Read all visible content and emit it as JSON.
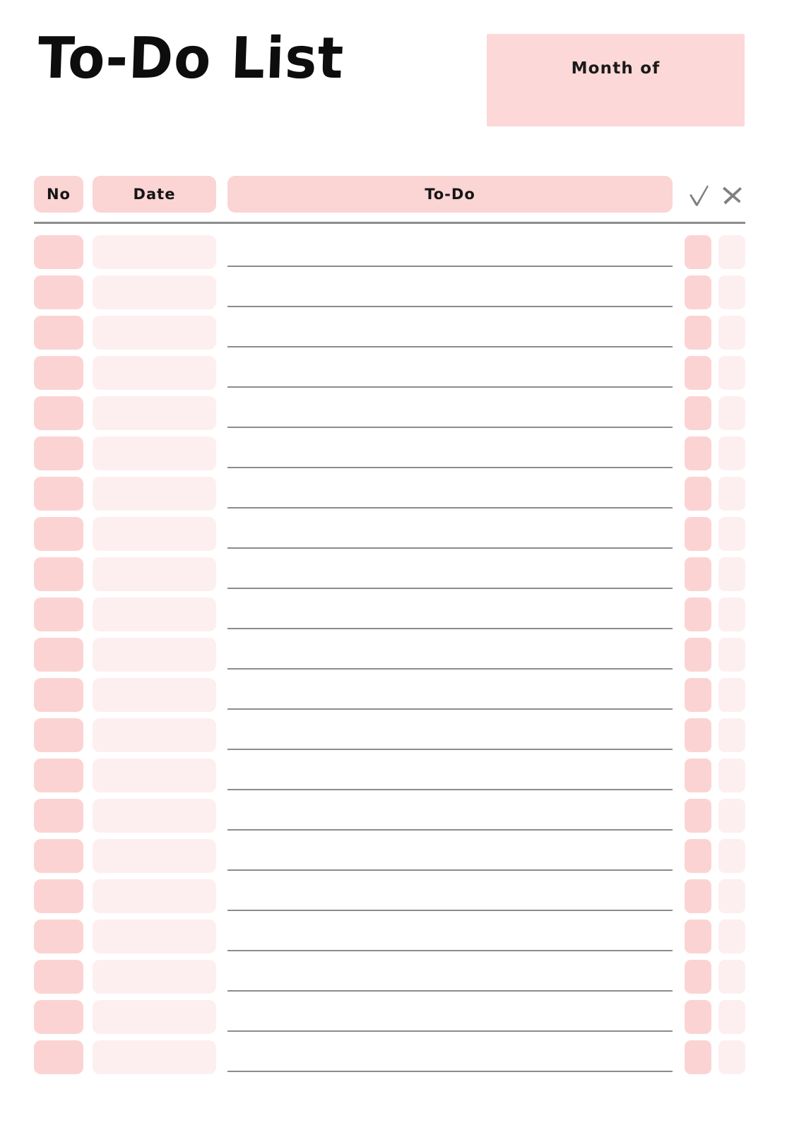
{
  "page": {
    "title": "To-Do List",
    "background_color": "#FFFFFF"
  },
  "header": {
    "month_box": {
      "label": "Month of",
      "value": "",
      "fill_color": "#FCD8D8"
    }
  },
  "table": {
    "columns": [
      {
        "key": "no",
        "label": "No",
        "type": "text",
        "fill_color": "#FBD4D4"
      },
      {
        "key": "date",
        "label": "Date",
        "type": "text",
        "fill_color": "#FBD4D4"
      },
      {
        "key": "todo",
        "label": "To-Do",
        "type": "text",
        "fill_color": "#FBD4D4"
      },
      {
        "key": "done",
        "label": "",
        "type": "icon",
        "icon": "check-icon",
        "icon_color": "#808080"
      },
      {
        "key": "undone",
        "label": "",
        "type": "icon",
        "icon": "cross-icon",
        "icon_color": "#808080"
      }
    ],
    "row_count": 21,
    "rows": [
      {
        "no": "",
        "date": "",
        "todo": "",
        "done": "",
        "undone": ""
      },
      {
        "no": "",
        "date": "",
        "todo": "",
        "done": "",
        "undone": ""
      },
      {
        "no": "",
        "date": "",
        "todo": "",
        "done": "",
        "undone": ""
      },
      {
        "no": "",
        "date": "",
        "todo": "",
        "done": "",
        "undone": ""
      },
      {
        "no": "",
        "date": "",
        "todo": "",
        "done": "",
        "undone": ""
      },
      {
        "no": "",
        "date": "",
        "todo": "",
        "done": "",
        "undone": ""
      },
      {
        "no": "",
        "date": "",
        "todo": "",
        "done": "",
        "undone": ""
      },
      {
        "no": "",
        "date": "",
        "todo": "",
        "done": "",
        "undone": ""
      },
      {
        "no": "",
        "date": "",
        "todo": "",
        "done": "",
        "undone": ""
      },
      {
        "no": "",
        "date": "",
        "todo": "",
        "done": "",
        "undone": ""
      },
      {
        "no": "",
        "date": "",
        "todo": "",
        "done": "",
        "undone": ""
      },
      {
        "no": "",
        "date": "",
        "todo": "",
        "done": "",
        "undone": ""
      },
      {
        "no": "",
        "date": "",
        "todo": "",
        "done": "",
        "undone": ""
      },
      {
        "no": "",
        "date": "",
        "todo": "",
        "done": "",
        "undone": ""
      },
      {
        "no": "",
        "date": "",
        "todo": "",
        "done": "",
        "undone": ""
      },
      {
        "no": "",
        "date": "",
        "todo": "",
        "done": "",
        "undone": ""
      },
      {
        "no": "",
        "date": "",
        "todo": "",
        "done": "",
        "undone": ""
      },
      {
        "no": "",
        "date": "",
        "todo": "",
        "done": "",
        "undone": ""
      },
      {
        "no": "",
        "date": "",
        "todo": "",
        "done": "",
        "undone": ""
      },
      {
        "no": "",
        "date": "",
        "todo": "",
        "done": "",
        "undone": ""
      },
      {
        "no": "",
        "date": "",
        "todo": "",
        "done": "",
        "undone": ""
      }
    ]
  },
  "colors": {
    "accent_pink": "#FBD4D4",
    "row_no_pink": "#FCD3D3",
    "row_date_pink": "#FDEFF0",
    "rule_gray": "#8C8C8C",
    "ink_black": "#0D0D0D"
  }
}
